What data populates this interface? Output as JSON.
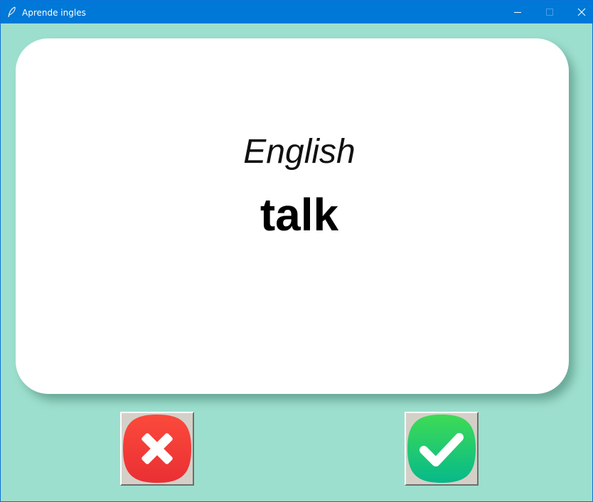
{
  "window": {
    "title": "Aprende ingles",
    "icons": {
      "app": "feather-icon",
      "minimize": "minimize-icon",
      "maximize": "maximize-icon",
      "close": "close-icon"
    }
  },
  "card": {
    "language": "English",
    "word": "talk"
  },
  "buttons": {
    "wrong": {
      "icon": "cross-icon",
      "color": "#f23a36"
    },
    "right": {
      "icon": "checkmark-icon",
      "color": "#1fc46e"
    }
  },
  "colors": {
    "background": "#9ddfce",
    "titlebar": "#0078d7",
    "card": "#ffffff"
  }
}
